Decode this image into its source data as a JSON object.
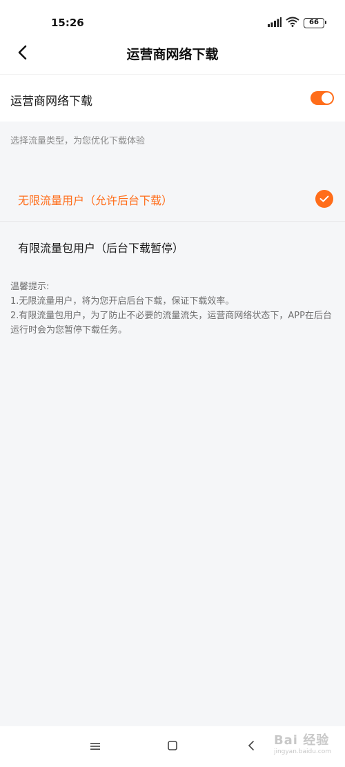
{
  "status_bar": {
    "time": "15:26",
    "battery": "66"
  },
  "nav": {
    "title": "运营商网络下载"
  },
  "setting": {
    "label": "运营商网络下载",
    "enabled": true
  },
  "hint": "选择流量类型，为您优化下载体验",
  "options": [
    {
      "label": "无限流量用户（允许后台下载）",
      "selected": true
    },
    {
      "label": "有限流量包用户（后台下载暂停）",
      "selected": false
    }
  ],
  "tips": {
    "title": "温馨提示:",
    "line1": "1.无限流量用户，将为您开启后台下载，保证下载效率。",
    "line2": "2.有限流量包用户，为了防止不必要的流量流失，运营商网络状态下，APP在后台运行时会为您暂停下载任务。"
  },
  "watermark": {
    "brand": "Bai 经验",
    "url": "jingyan.baidu.com"
  },
  "colors": {
    "accent": "#ff6d1a",
    "background": "#f5f6f8"
  },
  "icons": [
    "signal-icon",
    "wifi-icon",
    "battery-icon",
    "back-arrow-icon",
    "check-icon",
    "menu-icon",
    "home-icon",
    "back-nav-icon"
  ]
}
